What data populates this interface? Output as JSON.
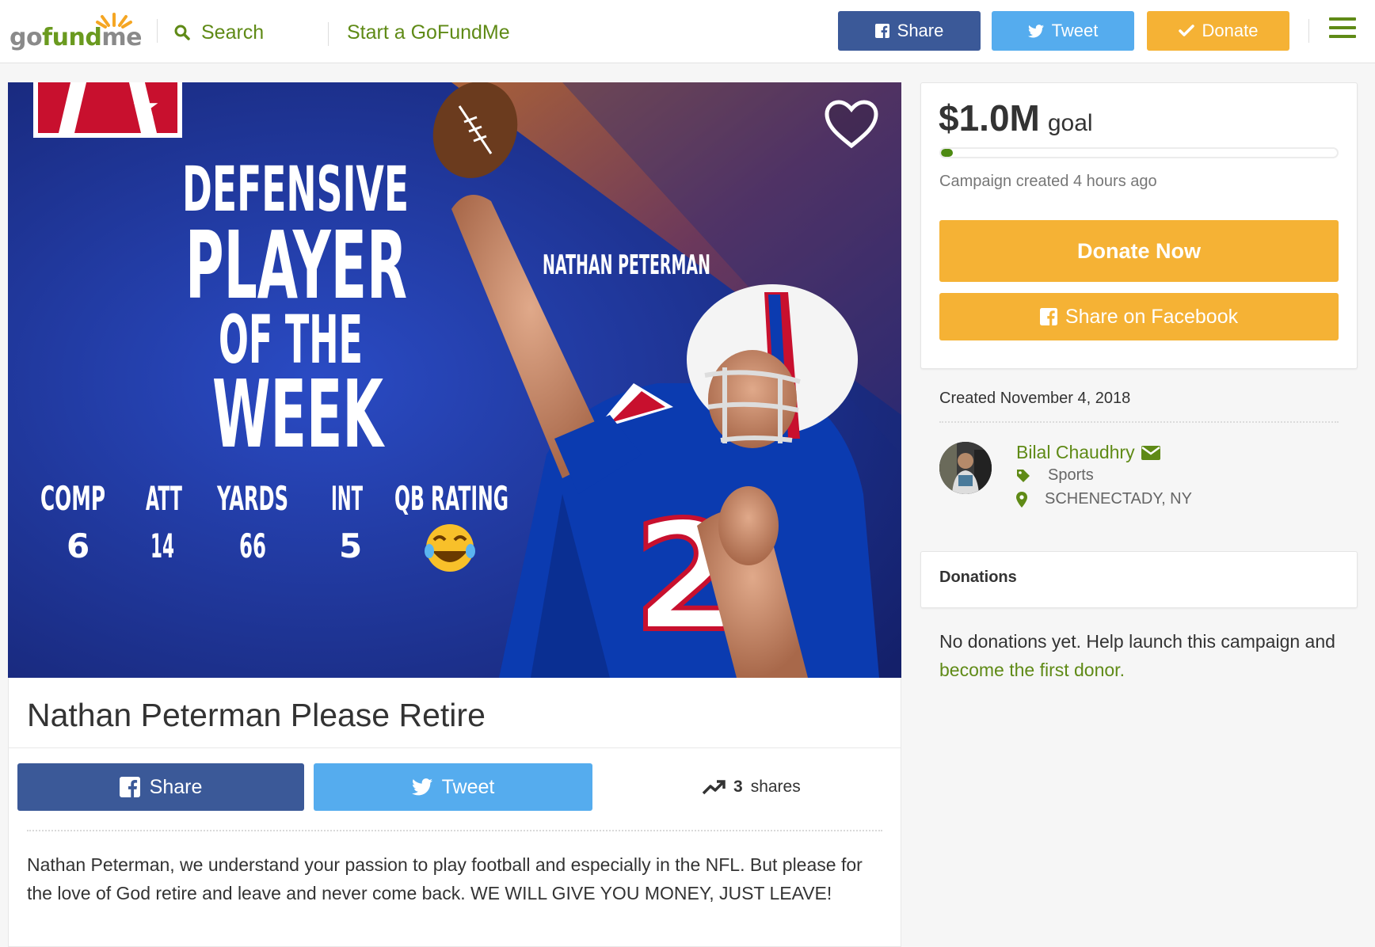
{
  "header": {
    "logo": "gofundme",
    "search_label": "Search",
    "start_label": "Start a GoFundMe",
    "share_label": "Share",
    "tweet_label": "Tweet",
    "donate_label": "Donate"
  },
  "hero": {
    "headline": [
      "DEFENSIVE",
      "PLAYER",
      "OF THE",
      "WEEK"
    ],
    "player_name": "NATHAN PETERMAN",
    "stats": [
      {
        "label": "COMP",
        "value": "6"
      },
      {
        "label": "ATT",
        "value": "14"
      },
      {
        "label": "YARDS",
        "value": "66"
      },
      {
        "label": "INT",
        "value": "5"
      },
      {
        "label": "QB RATING",
        "value": "😂"
      }
    ],
    "jersey_number": "2"
  },
  "campaign": {
    "title": "Nathan Peterman Please Retire",
    "share_label": "Share",
    "tweet_label": "Tweet",
    "shares_count": "3",
    "shares_label": "shares",
    "story": "Nathan Peterman, we understand your passion to play football and especially in the NFL.  But please for the love of God retire and leave and never come back.  WE WILL GIVE YOU MONEY, JUST LEAVE!"
  },
  "sidebar": {
    "goal_amount": "$1.0M",
    "goal_label": "goal",
    "progress_fraction": 0.03,
    "created_ago": "Campaign created 4 hours ago",
    "donate_now_label": "Donate Now",
    "share_facebook_label": "Share on Facebook",
    "created_date": "Created November 4, 2018",
    "organizer_name": "Bilal Chaudhry",
    "category": "Sports",
    "location": "SCHENECTADY, NY",
    "donations_title": "Donations",
    "no_donations_text": "No donations yet. Help launch this campaign and ",
    "first_donor_link": "become the first donor."
  },
  "colors": {
    "brand_green": "#5f8a16",
    "facebook_blue": "#3b5998",
    "twitter_blue": "#55acee",
    "donate_orange": "#f5b235"
  }
}
